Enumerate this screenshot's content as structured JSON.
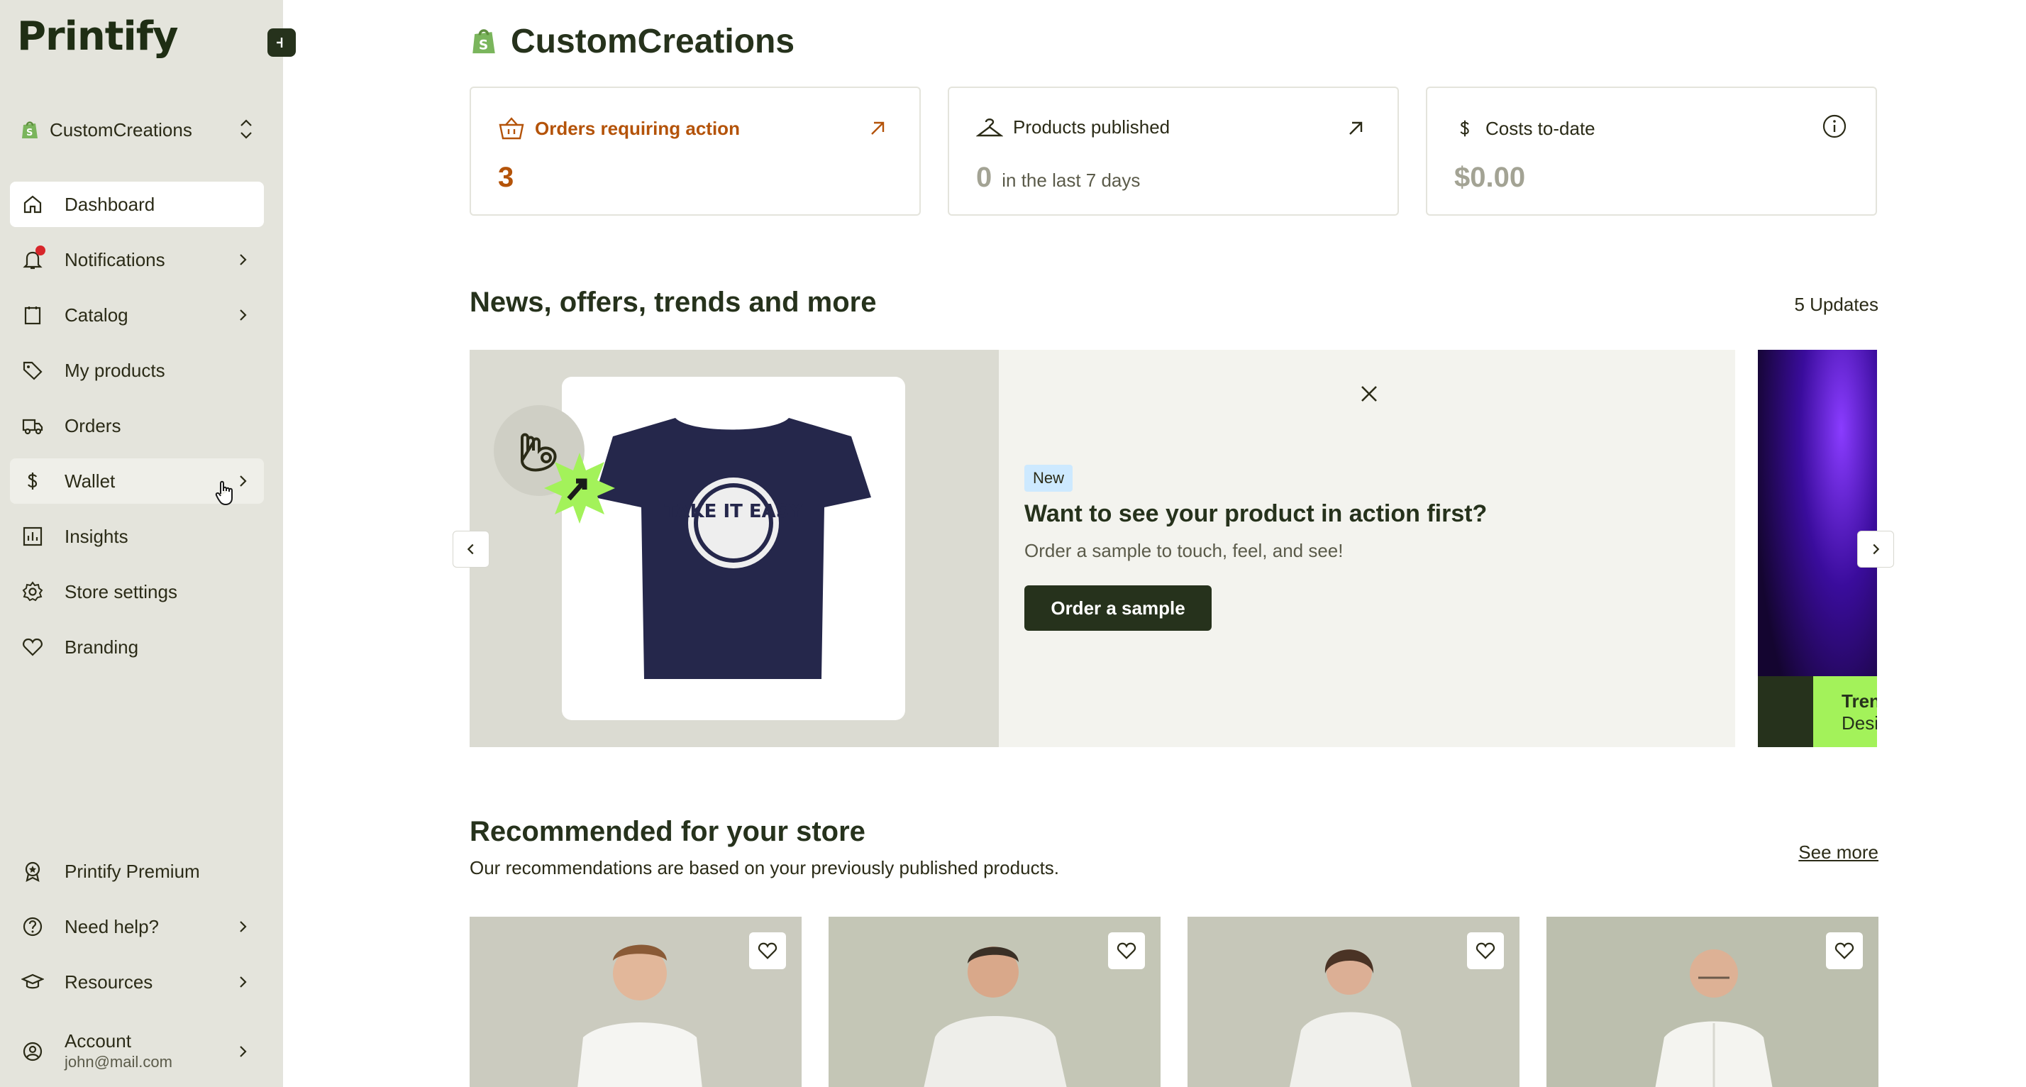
{
  "brand": {
    "logo_text": "Printify"
  },
  "sidebar": {
    "store_name": "CustomCreations",
    "items": [
      {
        "label": "Dashboard"
      },
      {
        "label": "Notifications"
      },
      {
        "label": "Catalog"
      },
      {
        "label": "My products"
      },
      {
        "label": "Orders"
      },
      {
        "label": "Wallet"
      },
      {
        "label": "Insights"
      },
      {
        "label": "Store settings"
      },
      {
        "label": "Branding"
      }
    ],
    "bottom_items": [
      {
        "label": "Printify Premium"
      },
      {
        "label": "Need help?"
      },
      {
        "label": "Resources"
      }
    ],
    "account": {
      "label": "Account",
      "email": "john@mail.com"
    }
  },
  "header": {
    "store_title": "CustomCreations"
  },
  "stats": {
    "orders": {
      "label": "Orders requiring action",
      "value": "3",
      "color": "#b45309"
    },
    "products": {
      "label": "Products published",
      "value": "0",
      "suffix": "in the last 7 days"
    },
    "costs": {
      "label": "Costs to-date",
      "value": "$0.00"
    }
  },
  "news": {
    "title": "News, offers, trends and more",
    "updates": "5 Updates",
    "banner": {
      "badge": "New",
      "heading": "Want to see your product in action first?",
      "body": "Order a sample to touch, feel, and see!",
      "cta": "Order a sample",
      "tee_print": "TAKE IT EASY"
    },
    "peek": {
      "line1": "Tren",
      "line2": "Desi"
    }
  },
  "recommended": {
    "title": "Recommended for your store",
    "subtitle": "Our recommendations are based on your previously published products.",
    "see_more": "See more"
  },
  "colors": {
    "accent_dark": "#26321c",
    "sidebar_bg": "#e4e4dc",
    "orders_accent": "#b45309",
    "lime": "#a3f25a"
  }
}
